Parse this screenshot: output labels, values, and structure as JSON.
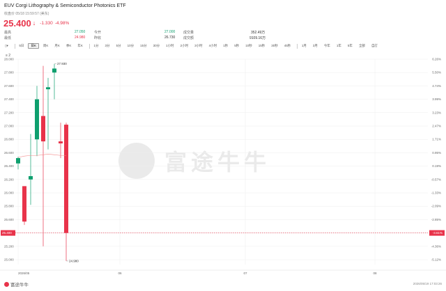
{
  "header": {
    "title": "EUV  Corgi Lithography & Semiconductor Photonics ETF",
    "subtitle": "收盘价 05/18 15:59:57 (美东)",
    "price": "25.400",
    "arrow": "↓",
    "change": "-1.330",
    "change_pct": "-4.98%"
  },
  "stats": {
    "row1": [
      {
        "label": "最高",
        "value": "27.050",
        "tone": "g"
      },
      {
        "label": "今开",
        "value": "27.000",
        "tone": "g"
      },
      {
        "label": "成交量",
        "value": "352.49万",
        "tone": "n"
      }
    ],
    "row2": [
      {
        "label": "最低",
        "value": "24.980",
        "tone": "r"
      },
      {
        "label": "昨收",
        "value": "26.730",
        "tone": "n"
      },
      {
        "label": "成交额",
        "value": "9109.16万",
        "tone": "n"
      }
    ]
  },
  "toolbar": {
    "layout_icon": "layout-icon",
    "items": [
      "5日",
      "日K",
      "周K",
      "月K",
      "季K",
      "年K",
      "1分",
      "3分",
      "5分",
      "10分",
      "15分",
      "30分",
      "1小时",
      "2小时",
      "3小时",
      "4小时",
      "1秒",
      "5秒",
      "10秒",
      "15秒",
      "30秒",
      "45秒",
      "1月",
      "3月",
      "今年",
      "1年",
      "5年",
      "全部",
      "自訂"
    ],
    "selected": "日K"
  },
  "indicator_toggle": "≡ 2",
  "chart_data": {
    "type": "candlestick",
    "y_ticks": [
      "28.000",
      "27.800",
      "27.600",
      "27.400",
      "27.200",
      "27.000",
      "26.800",
      "26.600",
      "26.400",
      "26.200",
      "26.000",
      "25.800",
      "25.600",
      "25.400",
      "25.200",
      "25.000"
    ],
    "y_ticks_num": [
      28.0,
      27.8,
      27.6,
      27.4,
      27.2,
      27.0,
      26.8,
      26.6,
      26.4,
      26.2,
      26.0,
      25.8,
      25.6,
      25.4,
      25.2,
      25.0
    ],
    "pct_ticks": [
      "6.26%",
      "5.50%",
      "4.74%",
      "3.99%",
      "3.23%",
      "2.47%",
      "1.71%",
      "0.95%",
      "0.19%",
      "-0.57%",
      "-1.33%",
      "-2.09%",
      "-2.85%",
      "-3.61%",
      "-4.36%",
      "-5.12%"
    ],
    "x_labels": [
      "2026/05",
      "06",
      "07",
      "08"
    ],
    "ylim": [
      25.0,
      28.0
    ],
    "last_price": 25.4,
    "last_price_label": "25.400",
    "last_pct_label": "-3.61%",
    "annotation_high": "27.930",
    "annotation_low": "24.980",
    "candles": [
      {
        "o": 26.44,
        "h": 26.54,
        "l": 26.35,
        "c": 26.52,
        "up": true
      },
      {
        "o": 26.1,
        "h": 26.1,
        "l": 25.52,
        "c": 25.57,
        "up": false
      },
      {
        "o": 26.2,
        "h": 26.88,
        "l": 25.82,
        "c": 26.25,
        "up": true
      },
      {
        "o": 26.8,
        "h": 27.6,
        "l": 26.55,
        "c": 27.4,
        "up": true
      },
      {
        "o": 27.15,
        "h": 27.9,
        "l": 25.2,
        "c": 26.77,
        "up": false
      },
      {
        "o": 27.55,
        "h": 27.72,
        "l": 26.65,
        "c": 27.58,
        "up": true
      },
      {
        "o": 27.8,
        "h": 27.93,
        "l": 27.4,
        "c": 27.86,
        "up": true
      },
      {
        "o": 26.74,
        "h": 27.05,
        "l": 26.52,
        "c": 26.77,
        "up": false
      },
      {
        "o": 27.02,
        "h": 27.05,
        "l": 24.98,
        "c": 25.4,
        "up": false
      }
    ],
    "ma_line": {
      "color": "#f28b8b",
      "values": [
        26.53,
        26.55,
        26.56,
        26.56,
        26.57,
        26.58,
        26.57,
        26.56,
        26.56
      ]
    }
  },
  "footer": {
    "logo": "富途牛牛",
    "timestamp": "2026/05/19 17:03:26"
  },
  "watermark": "富途牛牛",
  "colors": {
    "up": "#0e9f6e",
    "down": "#e8334a",
    "grid": "#eeeeee"
  }
}
